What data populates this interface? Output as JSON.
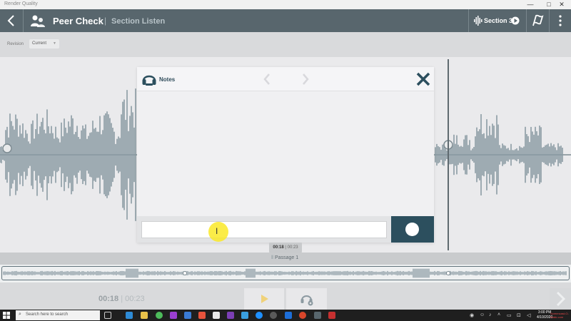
{
  "window": {
    "app_name": "Render Quality",
    "controls": [
      "—",
      "□",
      "✕"
    ]
  },
  "header": {
    "title": "Peer Check",
    "divider": "|",
    "subtitle": "Section Listen",
    "section_label": "Section 3"
  },
  "revision": {
    "label": "Revision",
    "selected": "Current"
  },
  "notes": {
    "title": "Notes",
    "input_placeholder": ""
  },
  "tooltip": {
    "current": "00:18",
    "sep": " | ",
    "total": "00:23"
  },
  "passage": {
    "label": "Passage 1"
  },
  "playback": {
    "current": "00:18",
    "sep": " | ",
    "total": "00:23"
  },
  "taskbar": {
    "search_placeholder": "Search here to search",
    "clock_time": "3:00 PM",
    "clock_date": "4/10/2020",
    "watermark": "Screencast-O-Matic.com"
  },
  "colors": {
    "header_bg": "#58666d",
    "accent_dark": "#2c4f5e",
    "waveform": "#8a9ba3",
    "cursor_highlight": "#fae928",
    "play_icon": "#f0d27a"
  }
}
